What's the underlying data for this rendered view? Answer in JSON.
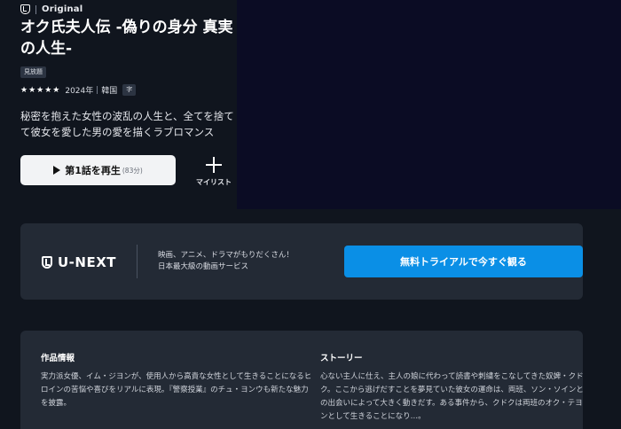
{
  "header": {
    "brand_label": "Original",
    "title": "オク氏夫人伝 -偽りの身分 真実の人生-",
    "availability_badge": "見放題",
    "stars": "★★★★★",
    "year": "2024年",
    "country": "韓国",
    "subtitle_badge": "字",
    "synopsis": "秘密を抱えた女性の波乱の人生と、全てを捨てて彼女を愛した男の愛を描くラブロマンス"
  },
  "actions": {
    "play_label": "第1話を再生",
    "play_duration": "(83分)",
    "mylist_label": "マイリスト"
  },
  "promo": {
    "logo_text": "U-NEXT",
    "copy_line1": "映画、アニメ、ドラマがもりだくさん！",
    "copy_line2": "日本最大級の動画サービス",
    "cta_label": "無料トライアルで今すぐ観る"
  },
  "info": {
    "work_heading": "作品情報",
    "work_body": "実力派女優、イム・ジヨンが、使用人から高貴な女性として生きることになるヒロインの苦悩や喜びをリアルに表現。『警察授業』のチュ・ヨンウも新たな魅力を披露。",
    "story_heading": "ストーリー",
    "story_body": "心ない主人に仕え、主人の娘に代わって読書や刺繍をこなしてきた奴婢・クドク。ここから逃げだすことを夢見ていた彼女の運命は、両班、ソン・ソインとの出会いによって大きく動きだす。ある事件から、クドクは両班のオク・テヨンとして生きることになり…。"
  },
  "colors": {
    "background": "#10151e",
    "hero_art": "#0b0c24",
    "card": "#232a35",
    "accent": "#0a8fe6"
  }
}
